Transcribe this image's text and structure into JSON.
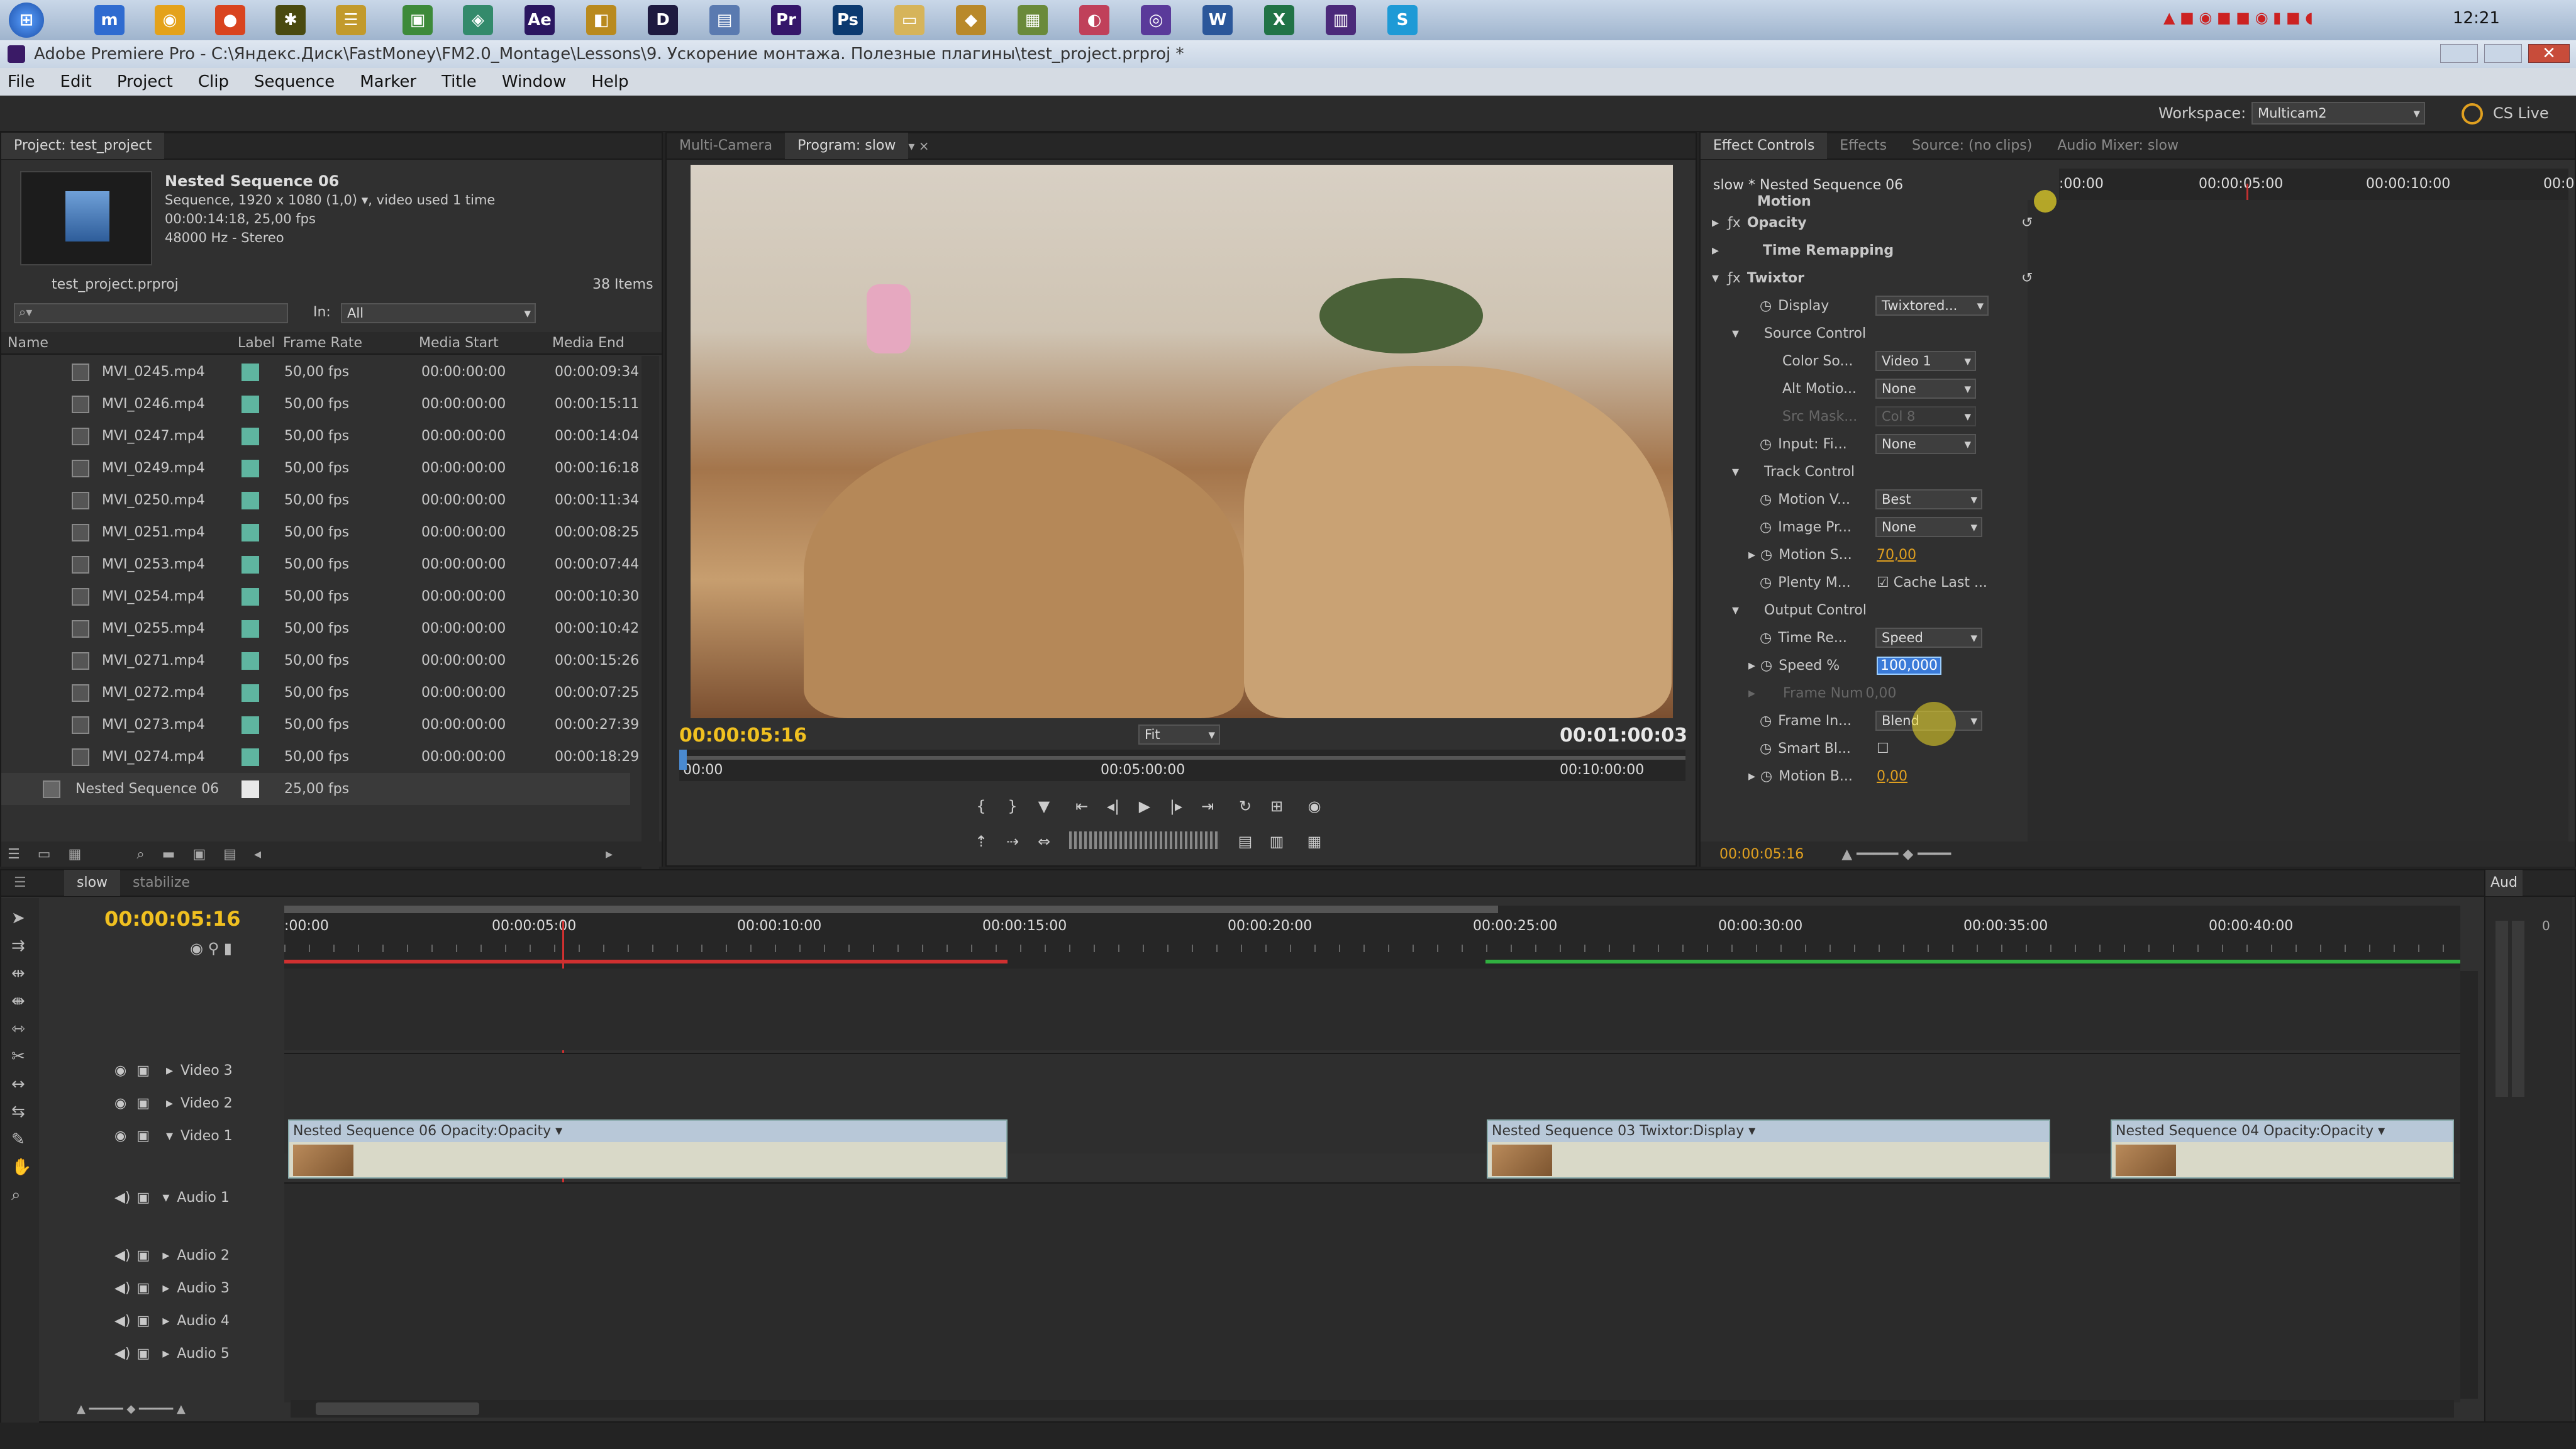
{
  "taskbar": {
    "clock": "12:21"
  },
  "window": {
    "title": "Adobe Premiere Pro - C:\\Яндекс.Диск\\FastMoney\\FM2.0_Montage\\Lessons\\9. Ускорение монтажа. Полезные плагины\\test_project.prproj *"
  },
  "menu": [
    "File",
    "Edit",
    "Project",
    "Clip",
    "Sequence",
    "Marker",
    "Title",
    "Window",
    "Help"
  ],
  "workspace": {
    "label": "Workspace:",
    "value": "Multicam2",
    "cs_live": "CS Live"
  },
  "project": {
    "tab": "Project: test_project",
    "seq_name": "Nested Sequence 06",
    "seq_line1": "Sequence, 1920 x 1080 (1,0)",
    "seq_line1b": ", video used 1 time",
    "seq_line2": "00:00:14:18, 25,00 fps",
    "seq_line3": "48000 Hz - Stereo",
    "file": "test_project.prproj",
    "items": "38 Items",
    "in_label": "In:",
    "in_value": "All",
    "columns": [
      "Name",
      "Label",
      "Frame Rate",
      "Media Start",
      "Media End"
    ],
    "rows": [
      {
        "name": "MVI_0245.mp4",
        "fps": "50,00 fps",
        "start": "00:00:00:00",
        "end": "00:00:09:34"
      },
      {
        "name": "MVI_0246.mp4",
        "fps": "50,00 fps",
        "start": "00:00:00:00",
        "end": "00:00:15:11"
      },
      {
        "name": "MVI_0247.mp4",
        "fps": "50,00 fps",
        "start": "00:00:00:00",
        "end": "00:00:14:04"
      },
      {
        "name": "MVI_0249.mp4",
        "fps": "50,00 fps",
        "start": "00:00:00:00",
        "end": "00:00:16:18"
      },
      {
        "name": "MVI_0250.mp4",
        "fps": "50,00 fps",
        "start": "00:00:00:00",
        "end": "00:00:11:34"
      },
      {
        "name": "MVI_0251.mp4",
        "fps": "50,00 fps",
        "start": "00:00:00:00",
        "end": "00:00:08:25"
      },
      {
        "name": "MVI_0253.mp4",
        "fps": "50,00 fps",
        "start": "00:00:00:00",
        "end": "00:00:07:44"
      },
      {
        "name": "MVI_0254.mp4",
        "fps": "50,00 fps",
        "start": "00:00:00:00",
        "end": "00:00:10:30"
      },
      {
        "name": "MVI_0255.mp4",
        "fps": "50,00 fps",
        "start": "00:00:00:00",
        "end": "00:00:10:42"
      },
      {
        "name": "MVI_0271.mp4",
        "fps": "50,00 fps",
        "start": "00:00:00:00",
        "end": "00:00:15:26"
      },
      {
        "name": "MVI_0272.mp4",
        "fps": "50,00 fps",
        "start": "00:00:00:00",
        "end": "00:00:07:25"
      },
      {
        "name": "MVI_0273.mp4",
        "fps": "50,00 fps",
        "start": "00:00:00:00",
        "end": "00:00:27:39"
      },
      {
        "name": "MVI_0274.mp4",
        "fps": "50,00 fps",
        "start": "00:00:00:00",
        "end": "00:00:18:29"
      },
      {
        "name": "Nested Sequence 06",
        "fps": "25,00 fps",
        "start": "",
        "end": ""
      }
    ]
  },
  "monitor": {
    "tab_multicam": "Multi-Camera",
    "tab_program": "Program: slow",
    "timecode_current": "00:00:05:16",
    "timecode_duration": "00:01:00:03",
    "fit": "Fit",
    "ruler": [
      "00:00",
      "00:05:00:00",
      "00:10:00:00"
    ]
  },
  "effects": {
    "tab_controls": "Effect Controls",
    "tab_effects": "Effects",
    "tab_source": "Source: (no clips)",
    "tab_mixer": "Audio Mixer: slow",
    "header": "slow * Nested Sequence 06",
    "ruler": [
      ":00:00",
      "00:00:05:00",
      "00:00:10:00",
      "00:0"
    ],
    "motion": "Motion",
    "opacity": "Opacity",
    "time_remapping": "Time Remapping",
    "twixtor": "Twixtor",
    "display": "Display",
    "display_val": "Twixtored...",
    "source_control": "Source Control",
    "color_so": "Color So...",
    "color_so_val": "Video 1",
    "alt_motio": "Alt Motio...",
    "alt_motio_val": "None",
    "src_mask": "Src Mask...",
    "src_mask_val": "Col 8",
    "input_fi": "Input: Fi...",
    "input_fi_val": "None",
    "track_control": "Track Control",
    "motion_v": "Motion V...",
    "motion_v_val": "Best",
    "image_pr": "Image Pr...",
    "image_pr_val": "None",
    "motion_s": "Motion S...",
    "motion_s_val": "70,00",
    "plenty_m": "Plenty M...",
    "cache_last": "Cache Last ...",
    "output_control": "Output Control",
    "time_re": "Time Re...",
    "time_re_val": "Speed",
    "speed": "Speed %",
    "speed_val": "100,000",
    "frame_num": "Frame Num",
    "frame_num_val": "0,00",
    "frame_in": "Frame In...",
    "frame_in_val": "Blend",
    "smart_bl": "Smart Bl...",
    "motion_b": "Motion B...",
    "motion_b_val": "0,00",
    "footer_tc": "00:00:05:16"
  },
  "timeline": {
    "tab_slow": "slow",
    "tab_stabilize": "stabilize",
    "timecode": "00:00:05:16",
    "ruler": [
      ":00:00",
      "00:00:05:00",
      "00:00:10:00",
      "00:00:15:00",
      "00:00:20:00",
      "00:00:25:00",
      "00:00:30:00",
      "00:00:35:00",
      "00:00:40:00"
    ],
    "tracks_video": [
      "Video 3",
      "Video 2",
      "Video 1"
    ],
    "tracks_audio": [
      "Audio 1",
      "Audio 2",
      "Audio 3",
      "Audio 4",
      "Audio 5"
    ],
    "clip1": {
      "name": "Nested Sequence 06",
      "fx": "Opacity:Opacity"
    },
    "clip2": {
      "name": "Nested Sequence 03",
      "fx": "Twixtor:Display"
    },
    "clip3": {
      "name": "Nested Sequence 04",
      "fx": "Opacity:Opacity"
    },
    "audio_panel": "Aud",
    "meter_top": "0"
  }
}
